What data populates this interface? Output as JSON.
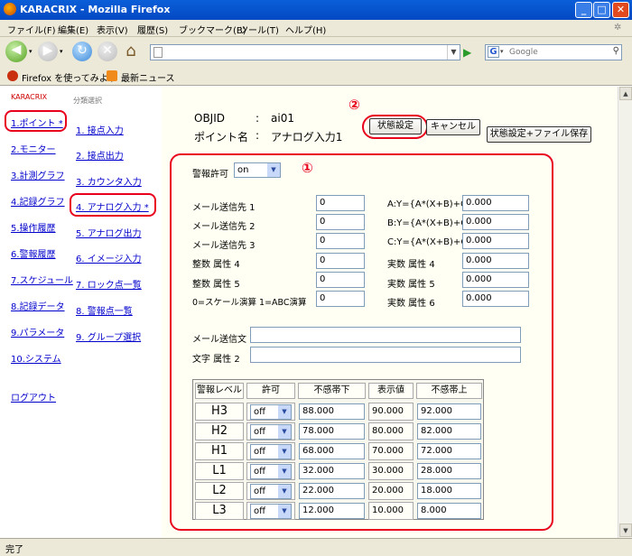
{
  "window": {
    "title": "KARACRIX - Mozilla Firefox",
    "min": "_",
    "max": "□",
    "close": "✕"
  },
  "menu": [
    "ファイル(F)",
    "編集(E)",
    "表示(V)",
    "履歴(S)",
    "ブックマーク(B)",
    "ツール(T)",
    "ヘルプ(H)"
  ],
  "toolbar": {
    "url": "",
    "search_placeholder": "Google"
  },
  "bookmarks": [
    "Firefox を使ってみよう",
    "最新ニュース"
  ],
  "sidebar": {
    "brand": "KARACRIX",
    "items": [
      "1.ポイント *",
      "2.モニター",
      "3.計測グラフ",
      "4.記録グラフ",
      "5.操作履歴",
      "6.警報履歴",
      "7.スケジュール",
      "8.記録データ",
      "9.パラメータ",
      "10.システム"
    ],
    "logout": "ログアウト"
  },
  "categories": {
    "title": "分類選択",
    "items": [
      "1. 接点入力",
      "2. 接点出力",
      "3. カウンタ入力",
      "4. アナログ入力 *",
      "5. アナログ出力",
      "6. イメージ入力",
      "7. ロック点一覧",
      "8. 警報点一覧",
      "9. グループ選択"
    ]
  },
  "header": {
    "objid_label": "OBJID",
    "point_label": "ポイント名",
    "sep": ":",
    "objid": "ai01",
    "point_name": "アナログ入力1"
  },
  "buttons": {
    "state": "状態設定",
    "cancel": "キャンセル",
    "save": "状態設定+ファイル保存"
  },
  "annotations": {
    "one": "①",
    "two": "②"
  },
  "alarm_enable": {
    "label": "警報許可",
    "value": "on"
  },
  "left_fields": [
    {
      "label": "メール送信先 1",
      "value": "0"
    },
    {
      "label": "メール送信先 2",
      "value": "0"
    },
    {
      "label": "メール送信先 3",
      "value": "0"
    },
    {
      "label": "整数 属性 4",
      "value": "0"
    },
    {
      "label": "整数 属性 5",
      "value": "0"
    },
    {
      "label": "0=スケール演算 1=ABC演算",
      "value": "0"
    }
  ],
  "right_fields": [
    {
      "label": "A:Y={A*(X+B)+C}",
      "value": "0.000"
    },
    {
      "label": "B:Y={A*(X+B)+C}",
      "value": "0.000"
    },
    {
      "label": "C:Y={A*(X+B)+C}",
      "value": "0.000"
    },
    {
      "label": "実数 属性 4",
      "value": "0.000"
    },
    {
      "label": "実数 属性 5",
      "value": "0.000"
    },
    {
      "label": "実数 属性 6",
      "value": "0.000"
    }
  ],
  "mail_text": {
    "label": "メール送信文",
    "value": ""
  },
  "text_attr": {
    "label": "文字 属性 2",
    "value": ""
  },
  "levels": {
    "headers": [
      "警報レベル",
      "許可",
      "不感帯下",
      "表示値",
      "不感帯上"
    ],
    "rows": [
      {
        "level": "H3",
        "enable": "off",
        "lower": "88.000",
        "display": "90.000",
        "upper": "92.000"
      },
      {
        "level": "H2",
        "enable": "off",
        "lower": "78.000",
        "display": "80.000",
        "upper": "82.000"
      },
      {
        "level": "H1",
        "enable": "off",
        "lower": "68.000",
        "display": "70.000",
        "upper": "72.000"
      },
      {
        "level": "L1",
        "enable": "off",
        "lower": "32.000",
        "display": "30.000",
        "upper": "28.000"
      },
      {
        "level": "L2",
        "enable": "off",
        "lower": "22.000",
        "display": "20.000",
        "upper": "18.000"
      },
      {
        "level": "L3",
        "enable": "off",
        "lower": "12.000",
        "display": "10.000",
        "upper": "8.000"
      }
    ]
  },
  "status": "完了"
}
